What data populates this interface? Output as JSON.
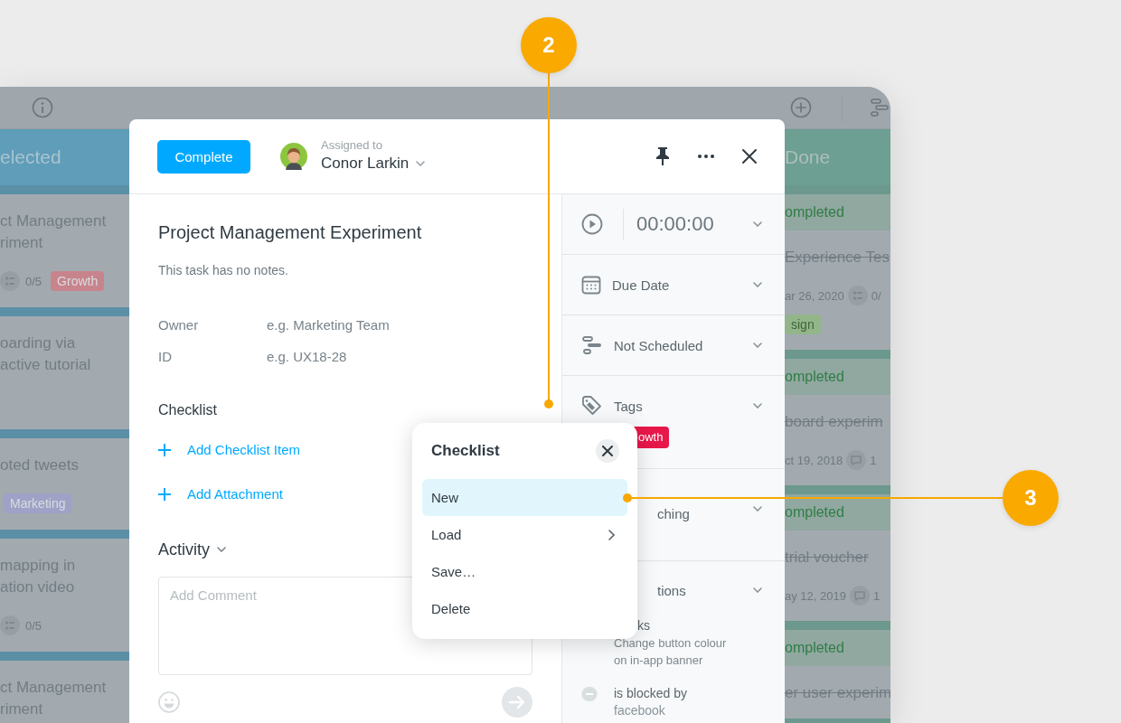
{
  "board": {
    "left_column": {
      "title": "elected",
      "cards": [
        {
          "lines": [
            "ct Management",
            "riment"
          ],
          "meta": {
            "kind": "checklist",
            "count": "0/5"
          },
          "tag": {
            "label": "Growth",
            "color": "#c8848d"
          }
        },
        {
          "lines": [
            "oarding via",
            "active tutorial"
          ]
        },
        {
          "lines": [
            "oted tweets"
          ],
          "tag": {
            "label": "Marketing",
            "color": "#9fa1c6"
          }
        },
        {
          "lines": [
            "mapping in",
            "ation video"
          ],
          "meta": {
            "kind": "checklist",
            "count": "0/5"
          }
        },
        {
          "lines": [
            "ct Management",
            "riment"
          ]
        }
      ]
    },
    "right_column": {
      "title": "Done",
      "cards": [
        {
          "status": "ompleted",
          "title": "Experience Tes",
          "done": true,
          "date": "ar 26, 2020",
          "meta": {
            "kind": "checklist",
            "count": "0/"
          },
          "tag": {
            "label": "sign",
            "color": "#92b58a"
          }
        },
        {
          "status": "ompleted",
          "title": "board experim",
          "done": true,
          "date": "ct 19, 2018",
          "meta": {
            "kind": "comment",
            "count": "1"
          }
        },
        {
          "status": "ompleted",
          "title": "trial voucher",
          "done": true,
          "date": "ay 12, 2019",
          "meta": {
            "kind": "comment",
            "count": "1"
          }
        },
        {
          "status": "ompleted",
          "title": "er user experim",
          "done": true
        }
      ]
    }
  },
  "task": {
    "complete_button": "Complete",
    "assignee_label": "Assigned to",
    "assignee": "Conor Larkin",
    "title": "Project Management Experiment",
    "notes": "This task has no notes.",
    "fields": [
      {
        "label": "Owner",
        "placeholder": "e.g. Marketing Team"
      },
      {
        "label": "ID",
        "placeholder": "e.g. UX18-28"
      }
    ],
    "checklist_heading": "Checklist",
    "actions": [
      "Add Checklist Item",
      "Add Attachment"
    ],
    "activity_heading": "Activity",
    "comment": {
      "placeholder": "Add Comment"
    },
    "sidebar": [
      {
        "kind": "timer",
        "label": "00:00:00"
      },
      {
        "kind": "date",
        "label": "Due Date"
      },
      {
        "kind": "schedule",
        "label": "Not Scheduled"
      },
      {
        "kind": "tags",
        "label": "Tags",
        "tags": [
          {
            "label": "owth",
            "color": "#e8174a"
          }
        ]
      },
      {
        "kind": "section",
        "label": "ching"
      },
      {
        "kind": "relations",
        "label": "tions",
        "items": [
          {
            "kind": "heading",
            "text": "ks"
          },
          {
            "kind": "item",
            "text": "Change button colour on in-app banner"
          },
          {
            "kind": "blocked",
            "relation": "is blocked by",
            "target": "facebook"
          }
        ]
      }
    ]
  },
  "checklist_menu": {
    "title": "Checklist",
    "items": [
      {
        "label": "New",
        "selected": true,
        "submenu": false
      },
      {
        "label": "Load",
        "selected": false,
        "submenu": true
      },
      {
        "label": "Save…",
        "selected": false,
        "submenu": false
      },
      {
        "label": "Delete",
        "selected": false,
        "submenu": false
      }
    ]
  },
  "callouts": [
    {
      "number": "2"
    },
    {
      "number": "3"
    }
  ]
}
